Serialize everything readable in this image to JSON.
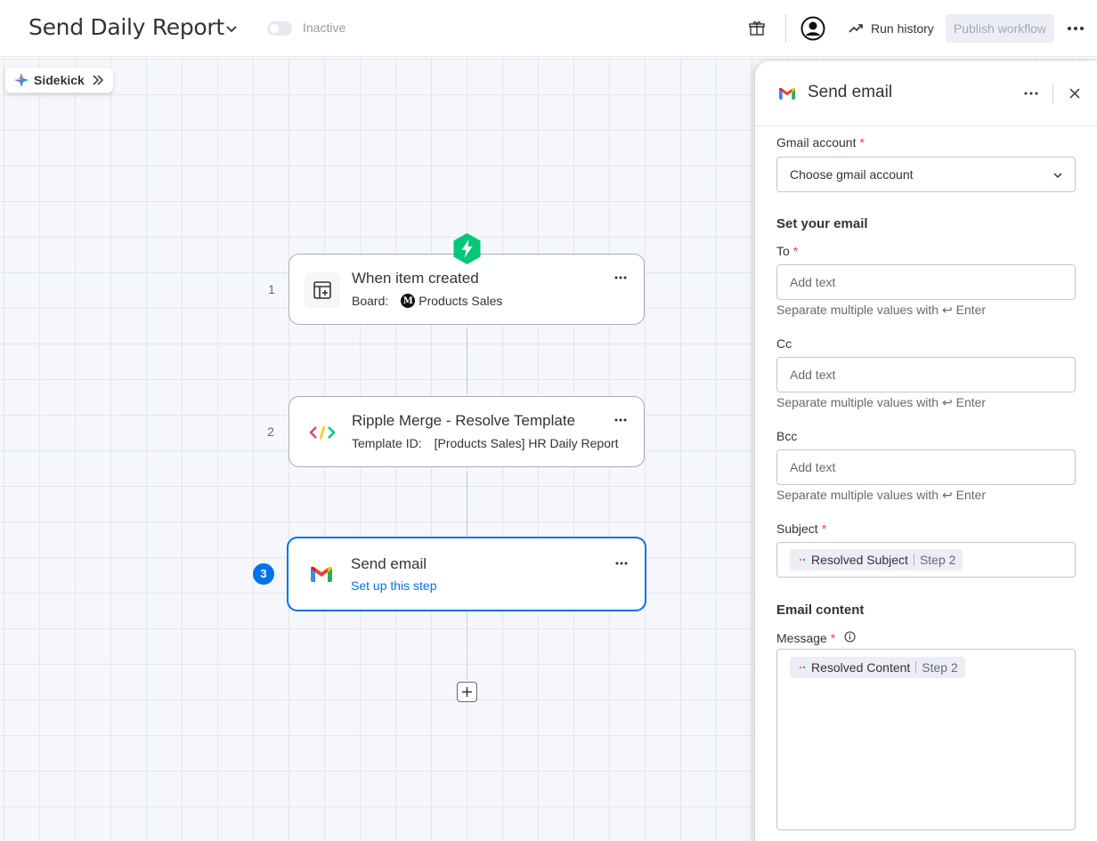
{
  "header": {
    "title": "Send Daily Report",
    "status": "Inactive",
    "run_history_label": "Run history",
    "publish_label": "Publish workflow"
  },
  "sidekick": {
    "label": "Sidekick"
  },
  "steps": [
    {
      "number": "1",
      "title": "When item created",
      "sub_label": "Board:",
      "board_initial": "M",
      "sub_value": "Products Sales"
    },
    {
      "number": "2",
      "title": "Ripple Merge - Resolve Template",
      "sub_label": "Template ID:",
      "sub_value": "[Products Sales] HR Daily Report"
    },
    {
      "number": "3",
      "title": "Send email",
      "link": "Set up this step"
    }
  ],
  "panel": {
    "title": "Send email",
    "gmail_account": {
      "label": "Gmail account",
      "required": "*",
      "placeholder": "Choose gmail account"
    },
    "set_email_title": "Set your email",
    "to": {
      "label": "To",
      "required": "*",
      "placeholder": "Add text",
      "hint": "Separate multiple values with ↩ Enter"
    },
    "cc": {
      "label": "Cc",
      "placeholder": "Add text",
      "hint": "Separate multiple values with ↩ Enter"
    },
    "bcc": {
      "label": "Bcc",
      "placeholder": "Add text",
      "hint": "Separate multiple values with ↩ Enter"
    },
    "subject": {
      "label": "Subject",
      "required": "*",
      "chip_label": "Resolved Subject",
      "chip_step": "Step 2"
    },
    "email_content_title": "Email content",
    "message": {
      "label": "Message",
      "required": "*",
      "chip_label": "Resolved Content",
      "chip_step": "Step 2"
    }
  },
  "colors": {
    "accent": "#0073ea",
    "trigger_badge": "#00c875",
    "required": "#e2445c"
  }
}
